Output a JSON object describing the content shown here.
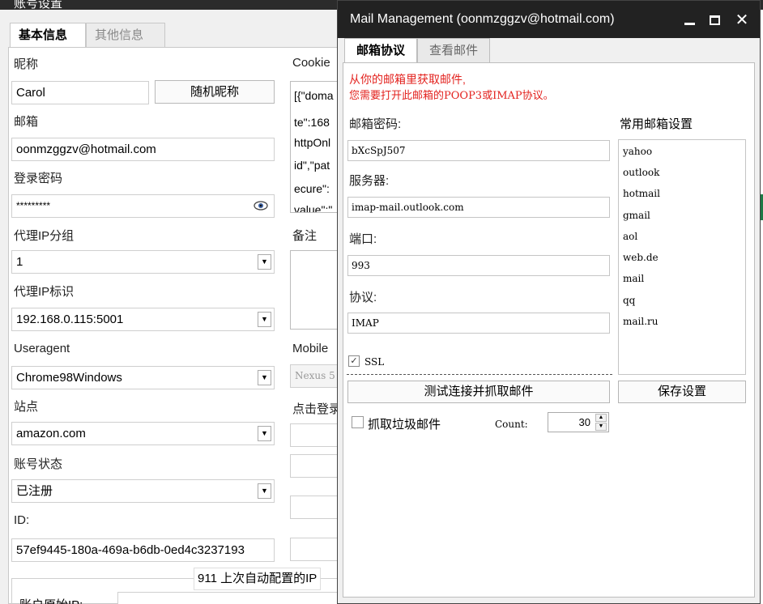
{
  "bg": {
    "title": "账号设置",
    "tabs": [
      "基本信息",
      "其他信息"
    ],
    "nickname_label": "昵称",
    "nickname_value": "Carol",
    "random_nick_button": "随机昵称",
    "email_label": "邮箱",
    "email_value": "oonmzggzv@hotmail.com",
    "password_label": "登录密码",
    "password_value": "*********",
    "proxy_group_label": "代理IP分组",
    "proxy_group_value": "1",
    "proxy_id_label": "代理IP标识",
    "proxy_id_value": "192.168.0.115:5001",
    "useragent_label": "Useragent",
    "useragent_value": "Chrome98Windows",
    "site_label": "站点",
    "site_value": "amazon.com",
    "status_label": "账号状态",
    "status_value": "已注册",
    "id_label": "ID:",
    "id_value": "57ef9445-180a-469a-b6db-0ed4c3237193",
    "cookie_label": "Cookie",
    "cookie_lines": [
      "[{\"doma",
      "te\":168",
      "httpOnl",
      "id\",\"pat",
      "ecure\":",
      "value\":\""
    ],
    "remark_label": "备注",
    "mobile_label": "Mobile",
    "mobile_value": "Nexus 5",
    "click_login_label": "点击登录",
    "ip_group_caption": "911 上次自动配置的IP",
    "orig_ip_label": "账户原始IP:"
  },
  "mail": {
    "title": "Mail Management  (oonmzggzv@hotmail.com)",
    "tabs": [
      "邮箱协议",
      "查看邮件"
    ],
    "hint_line1": "从你的邮箱里获取邮件,",
    "hint_line2": "您需要打开此邮箱的POOP3或IMAP协议。",
    "password_label": "邮箱密码:",
    "password_value": "bXcSpJ507",
    "server_label": "服务器:",
    "server_value": "imap-mail.outlook.com",
    "port_label": "端口:",
    "port_value": "993",
    "protocol_label": "协议:",
    "protocol_value": "IMAP",
    "common_label": "常用邮箱设置",
    "common_list": [
      "yahoo",
      "outlook",
      "hotmail",
      "gmail",
      "aol",
      "web.de",
      "mail",
      "qq",
      "mail.ru"
    ],
    "ssl_label": "SSL",
    "ssl_checked": true,
    "test_button": "测试连接并抓取邮件",
    "save_button": "保存设置",
    "junk_label": "抓取垃圾邮件",
    "junk_checked": false,
    "count_label": "Count:",
    "count_value": "30"
  }
}
